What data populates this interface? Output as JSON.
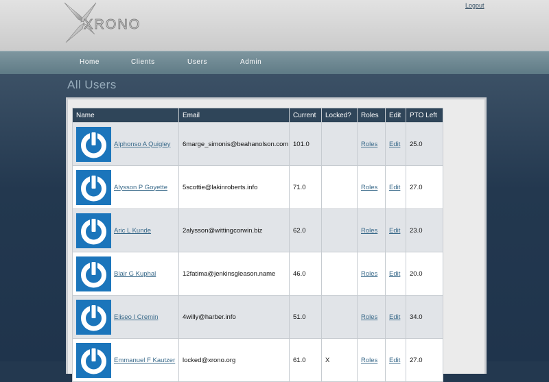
{
  "header": {
    "logo_text": "XRONO",
    "logout_label": "Logout"
  },
  "nav": {
    "items": [
      "Home",
      "Clients",
      "Users",
      "Admin"
    ]
  },
  "page": {
    "title": "All Users"
  },
  "table": {
    "columns": [
      "Name",
      "Email",
      "Current",
      "Locked?",
      "Roles",
      "Edit",
      "PTO Left"
    ],
    "rows": [
      {
        "name": "Alphonso A Quigley",
        "email": "6marge_simonis@beahanolson.com",
        "current": "101.0",
        "locked": "",
        "roles": "Roles",
        "edit": "Edit",
        "pto": "25.0"
      },
      {
        "name": "Alysson P Goyette",
        "email": "5scottie@lakinroberts.info",
        "current": "71.0",
        "locked": "",
        "roles": "Roles",
        "edit": "Edit",
        "pto": "27.0"
      },
      {
        "name": "Aric L Kunde",
        "email": "2alysson@wittingcorwin.biz",
        "current": "62.0",
        "locked": "",
        "roles": "Roles",
        "edit": "Edit",
        "pto": "23.0"
      },
      {
        "name": "Blair G Kuphal",
        "email": "12fatima@jenkinsgleason.name",
        "current": "46.0",
        "locked": "",
        "roles": "Roles",
        "edit": "Edit",
        "pto": "20.0"
      },
      {
        "name": "Eliseo I Cremin",
        "email": "4willy@harber.info",
        "current": "51.0",
        "locked": "",
        "roles": "Roles",
        "edit": "Edit",
        "pto": "34.0"
      },
      {
        "name": "Emmanuel F Kautzer",
        "email": "locked@xrono.org",
        "current": "61.0",
        "locked": "X",
        "roles": "Roles",
        "edit": "Edit",
        "pto": "27.0"
      }
    ]
  },
  "colors": {
    "avatar": "#1b75bb",
    "header_row": "#2f4559",
    "link": "#3a6a8a"
  }
}
